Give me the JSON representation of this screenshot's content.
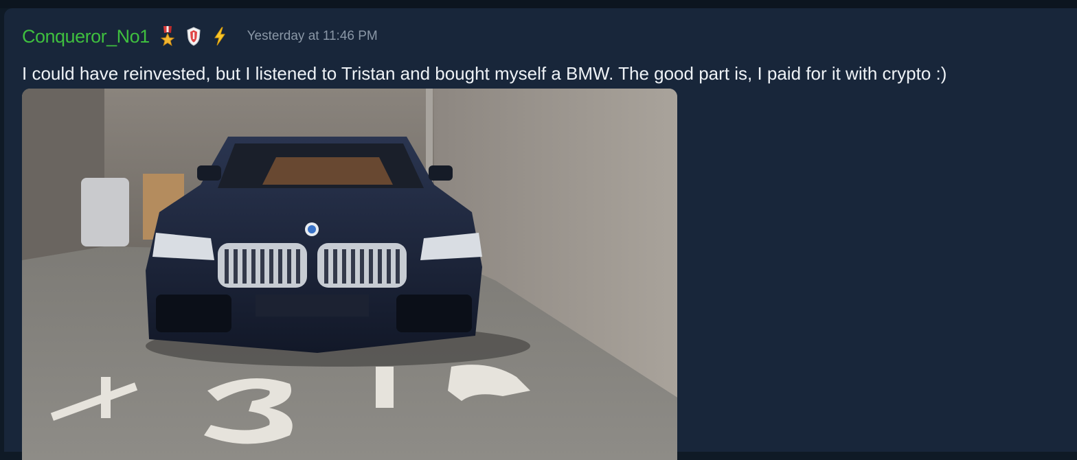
{
  "message": {
    "username": "Conqueror_No1",
    "badges": [
      "medal-icon",
      "shield-icon",
      "lightning-icon"
    ],
    "timestamp": "Yesterday at 11:46 PM",
    "text": "I could have reinvested, but I listened to Tristan and bought myself a BMW. The good part is, I paid for it with crypto :)"
  },
  "colors": {
    "username": "#3fbf3f",
    "timestamp": "#8a97a6",
    "message_bg": "#18263a",
    "text": "#eef2f6"
  }
}
